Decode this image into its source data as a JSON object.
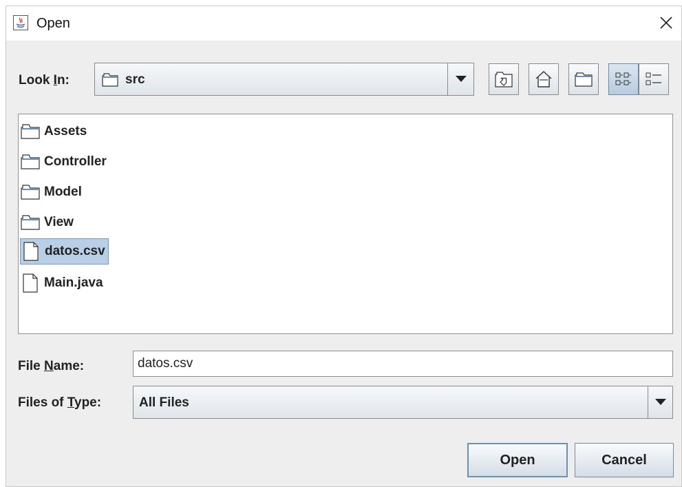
{
  "window": {
    "title": "Open",
    "close_icon": "close-icon"
  },
  "look_in": {
    "label_pre": "Look ",
    "label_mnemonic": "I",
    "label_post": "n:",
    "value": "src"
  },
  "toolbar": {
    "icons": [
      "up-one-level-icon",
      "home-icon",
      "new-folder-icon",
      "list-view-icon",
      "details-view-icon"
    ],
    "active_view": "list-view"
  },
  "files": [
    {
      "name": "Assets",
      "type": "folder",
      "selected": false
    },
    {
      "name": "Controller",
      "type": "folder",
      "selected": false
    },
    {
      "name": "Model",
      "type": "folder",
      "selected": false
    },
    {
      "name": "View",
      "type": "folder",
      "selected": false
    },
    {
      "name": "datos.csv",
      "type": "file",
      "selected": true
    },
    {
      "name": "Main.java",
      "type": "file",
      "selected": false
    }
  ],
  "file_name": {
    "label_pre": "File ",
    "label_mnemonic": "N",
    "label_post": "ame:",
    "value": "datos.csv"
  },
  "file_type": {
    "label_pre": "Files of ",
    "label_mnemonic": "T",
    "label_post": "ype:",
    "value": "All Files"
  },
  "buttons": {
    "open": "Open",
    "cancel": "Cancel"
  },
  "colors": {
    "selection": "#b8cfe5",
    "panel": "#eeeeee"
  }
}
